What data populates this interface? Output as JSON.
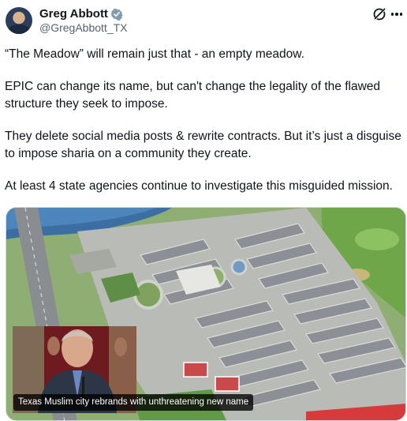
{
  "author": {
    "name": "Greg Abbott",
    "handle": "@GregAbbott_TX",
    "verified_icon": "verified-badge-icon",
    "accent_color": "#1d9bf0"
  },
  "actions": {
    "grok_icon": "grok-icon",
    "more_icon": "more-icon"
  },
  "tweet": {
    "paragraphs": [
      "“The Meadow” will remain just that - an empty meadow.",
      "EPIC can change its name, but can't change the legality of the flawed structure they seek to impose.",
      "They delete social media posts & rewrite contracts. But it’s just a disguise to impose sharia on a community they create.",
      "At least 4 state agencies continue to investigate this misguided mission."
    ]
  },
  "media": {
    "caption": "Texas Muslim city rebrands with unthreatening new name"
  }
}
